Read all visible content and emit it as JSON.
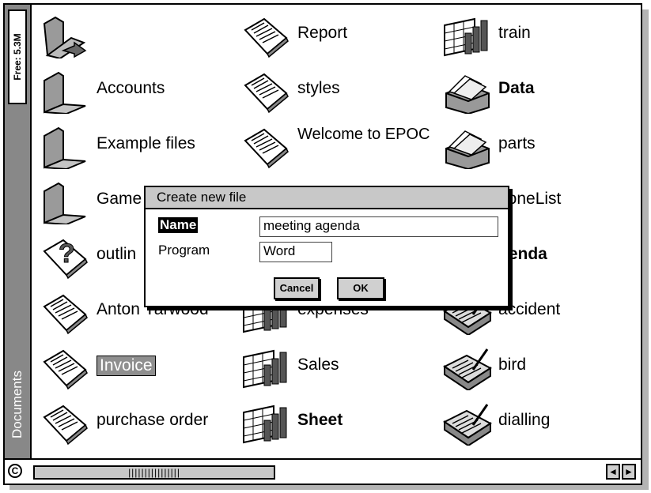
{
  "sidebar": {
    "free_space": "Free: 5.3M",
    "title": "Documents",
    "clip_icon": "C"
  },
  "files": [
    {
      "label": "",
      "icon": "folder-up-icon",
      "bold": false
    },
    {
      "label": "Report",
      "icon": "document-icon",
      "bold": false
    },
    {
      "label": "train",
      "icon": "sheet-icon",
      "bold": false
    },
    {
      "label": "Accounts",
      "icon": "folder-icon",
      "bold": false
    },
    {
      "label": "styles",
      "icon": "document-icon",
      "bold": false
    },
    {
      "label": "Data",
      "icon": "database-icon",
      "bold": true
    },
    {
      "label": "Example files",
      "icon": "folder-icon",
      "bold": false
    },
    {
      "label": "Welcome to EPOC",
      "icon": "document-icon",
      "bold": false
    },
    {
      "label": "parts",
      "icon": "database-icon",
      "bold": false
    },
    {
      "label": "Game",
      "icon": "folder-icon",
      "bold": false
    },
    {
      "label": "",
      "icon": "",
      "bold": false
    },
    {
      "label": "honeList",
      "icon": "",
      "bold": false
    },
    {
      "label": "outlin",
      "icon": "help-document-icon",
      "bold": false
    },
    {
      "label": "",
      "icon": "",
      "bold": false
    },
    {
      "label": "genda",
      "icon": "",
      "bold": true
    },
    {
      "label": "Anton Yarwood",
      "icon": "document-icon",
      "bold": false
    },
    {
      "label": "expenses",
      "icon": "sheet-icon",
      "bold": false
    },
    {
      "label": "accident",
      "icon": "agenda-icon",
      "bold": false
    },
    {
      "label": "Invoice",
      "icon": "document-icon",
      "bold": false,
      "selected": true
    },
    {
      "label": "Sales",
      "icon": "sheet-icon",
      "bold": false
    },
    {
      "label": "bird",
      "icon": "agenda-icon",
      "bold": false
    },
    {
      "label": "purchase order",
      "icon": "document-icon",
      "bold": false
    },
    {
      "label": "Sheet",
      "icon": "sheet-icon",
      "bold": true
    },
    {
      "label": "dialling",
      "icon": "agenda-icon",
      "bold": false
    }
  ],
  "dialog": {
    "title": "Create new file",
    "name_label": "Name",
    "name_value": "meeting agenda",
    "program_label": "Program",
    "program_value": "Word",
    "cancel_label": "Cancel",
    "ok_label": "OK"
  },
  "scrollbar": {
    "thumb_text": "||||||||||||||||",
    "left_arrow": "◄",
    "right_arrow": "►"
  },
  "colors": {
    "sidebar": "#888888",
    "selection": "#8f8f8f",
    "dialog_title": "#c8c8c8"
  }
}
